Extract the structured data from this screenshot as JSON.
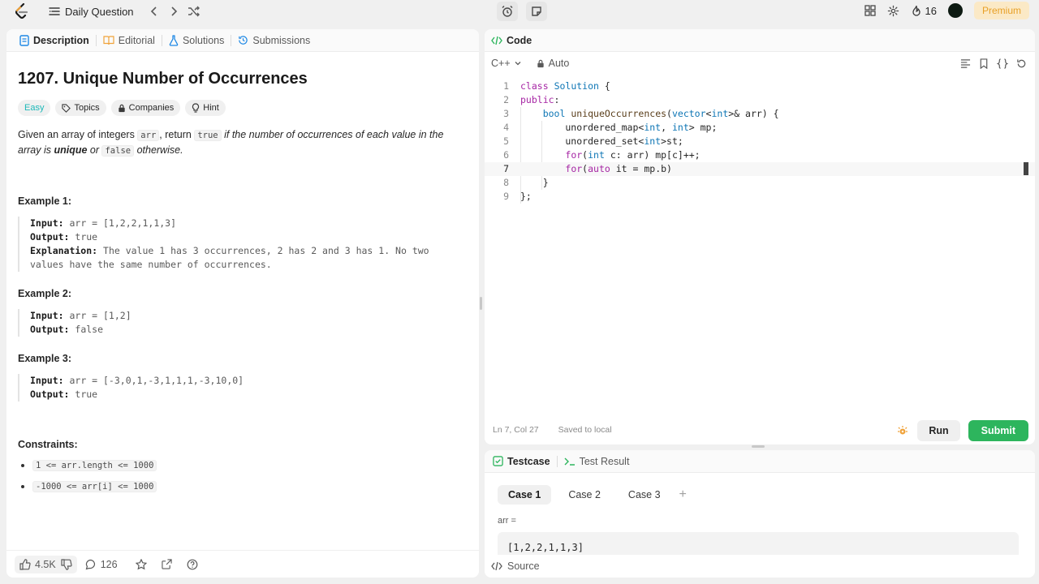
{
  "topbar": {
    "daily_label": "Daily Question",
    "streak_count": "16",
    "premium_label": "Premium"
  },
  "desc_tabs": [
    {
      "label": "Description"
    },
    {
      "label": "Editorial"
    },
    {
      "label": "Solutions"
    },
    {
      "label": "Submissions"
    }
  ],
  "problem": {
    "title": "1207. Unique Number of Occurrences",
    "difficulty": "Easy",
    "tags": [
      "Topics",
      "Companies",
      "Hint"
    ],
    "stmt_1": "Given an array of integers ",
    "stmt_arr": "arr",
    "stmt_2": ", return ",
    "stmt_true": "true",
    "stmt_3": " if the number of occurrences of each value in the array is ",
    "stmt_unique": "unique",
    "stmt_4": " or ",
    "stmt_false": "false",
    "stmt_5": " otherwise."
  },
  "examples": [
    {
      "title": "Example 1:",
      "input_label": "Input:",
      "input": " arr = [1,2,2,1,1,3]",
      "output_label": "Output:",
      "output": " true",
      "expl_label": "Explanation:",
      "expl_1": " The value 1 has 3 occurrences, 2 has 2 and 3 has 1. No two",
      "expl_2": "values have the same number of occurrences."
    },
    {
      "title": "Example 2:",
      "input_label": "Input:",
      "input": " arr = [1,2]",
      "output_label": "Output:",
      "output": " false"
    },
    {
      "title": "Example 3:",
      "input_label": "Input:",
      "input": " arr = [-3,0,1,-3,1,1,1,-3,10,0]",
      "output_label": "Output:",
      "output": " true"
    }
  ],
  "constraints": {
    "title": "Constraints:",
    "items": [
      "1 <= arr.length <= 1000",
      "-1000 <= arr[i] <= 1000"
    ]
  },
  "left_footer": {
    "likes": "4.5K",
    "comments": "126"
  },
  "code": {
    "tab_label": "Code",
    "language": "C++",
    "mode": "Auto",
    "lines": [
      "class Solution {",
      "public:",
      "    bool uniqueOccurrences(vector<int>& arr) {",
      "        unordered_map<int, int> mp;",
      "        unordered_set<int>st;",
      "        for(int c: arr) mp[c]++;",
      "        for(auto it = mp.b)",
      "    }",
      "};"
    ],
    "cursor_pos": "Ln 7, Col 27",
    "save_status": "Saved to local",
    "run_label": "Run",
    "submit_label": "Submit"
  },
  "test": {
    "testcase_label": "Testcase",
    "result_label": "Test Result",
    "cases": [
      "Case 1",
      "Case 2",
      "Case 3"
    ],
    "add_label": "+",
    "arr_label": "arr =",
    "arr_value": "[1,2,2,1,1,3]",
    "source_label": "Source"
  }
}
